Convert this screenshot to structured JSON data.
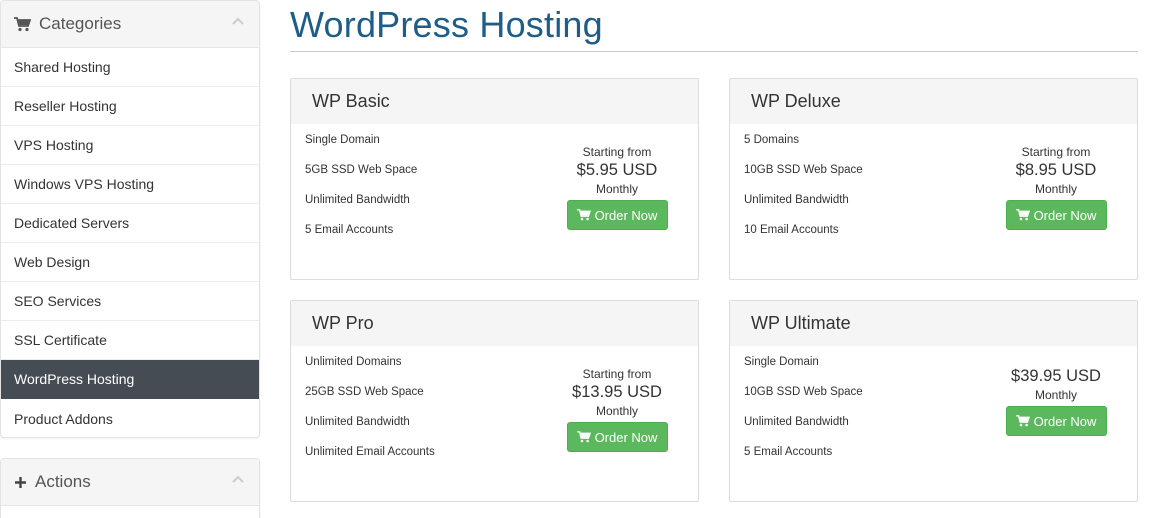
{
  "sidebar": {
    "categories_title": "Categories",
    "items": [
      {
        "label": "Shared Hosting"
      },
      {
        "label": "Reseller Hosting"
      },
      {
        "label": "VPS Hosting"
      },
      {
        "label": "Windows VPS Hosting"
      },
      {
        "label": "Dedicated Servers"
      },
      {
        "label": "Web Design"
      },
      {
        "label": "SEO Services"
      },
      {
        "label": "SSL Certificate"
      },
      {
        "label": "WordPress Hosting",
        "active": true
      },
      {
        "label": "Product Addons"
      }
    ],
    "actions_title": "Actions"
  },
  "page": {
    "title": "WordPress Hosting"
  },
  "products": [
    {
      "name": "WP Basic",
      "features": [
        "Single Domain",
        "5GB SSD Web Space",
        "Unlimited Bandwidth",
        "5 Email Accounts"
      ],
      "starting_from": "Starting from",
      "price": "$5.95 USD",
      "cycle": "Monthly",
      "order_label": "Order Now"
    },
    {
      "name": "WP Deluxe",
      "features": [
        "5 Domains",
        "10GB SSD Web Space",
        "Unlimited Bandwidth",
        "10 Email Accounts"
      ],
      "starting_from": "Starting from",
      "price": "$8.95 USD",
      "cycle": "Monthly",
      "order_label": "Order Now"
    },
    {
      "name": "WP Pro",
      "features": [
        "Unlimited Domains",
        "25GB SSD Web Space",
        "Unlimited Bandwidth",
        "Unlimited Email Accounts"
      ],
      "starting_from": "Starting from",
      "price": "$13.95 USD",
      "cycle": "Monthly",
      "order_label": "Order Now"
    },
    {
      "name": "WP Ultimate",
      "features": [
        "Single Domain",
        "10GB SSD Web Space",
        "Unlimited Bandwidth",
        "5 Email Accounts"
      ],
      "price": "$39.95 USD",
      "cycle": "Monthly",
      "order_label": "Order Now"
    }
  ],
  "colors": {
    "title_blue": "#1d5d87",
    "order_green": "#5cb85c",
    "active_item_bg": "#454c53"
  },
  "icons": {
    "categories": "shopping-cart-icon",
    "actions": "plus-icon",
    "collapse": "chevron-up-icon",
    "order": "shopping-cart-icon"
  }
}
